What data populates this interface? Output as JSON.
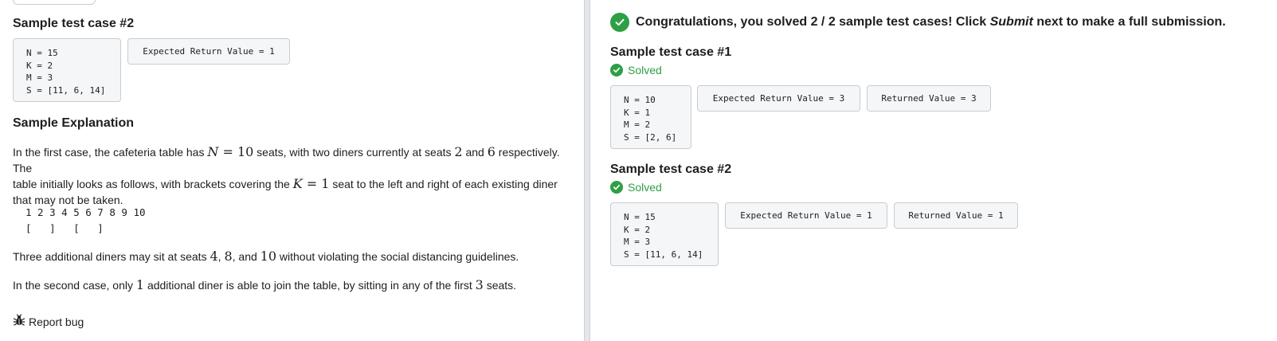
{
  "left": {
    "sample2": {
      "title": "Sample test case #2",
      "input_lines": [
        "N = 15",
        "K = 2",
        "M = 3",
        "S = [11, 6, 14]"
      ],
      "expected": "Expected Return Value = 1"
    },
    "explanation": {
      "title": "Sample Explanation",
      "p1_a": "In the first case, the cafeteria table has ",
      "p1_N": "N",
      "p1_eq1": " = ",
      "p1_10": "10",
      "p1_b": " seats, with two diners currently at seats ",
      "p1_2": "2",
      "p1_and": " and ",
      "p1_6": "6",
      "p1_c": " respectively. The",
      "p1_d": "table initially looks as follows, with brackets covering the ",
      "p1_K": "K",
      "p1_eq2": " = ",
      "p1_1": "1",
      "p1_e": " seat to the left and right of each existing diner",
      "p1_f": "that may not be taken.",
      "seat_numbers": "1 2 3 4 5 6 7 8 9 10",
      "seat_brackets": "[   ]   [   ]",
      "p2_a": "Three additional diners may sit at seats ",
      "p2_4": "4",
      "p2_c1": ", ",
      "p2_8": "8",
      "p2_c2": ", and ",
      "p2_10": "10",
      "p2_b": " without violating the social distancing guidelines.",
      "p3_a": "In the second case, only ",
      "p3_1": "1",
      "p3_b": " additional diner is able to join the table, by sitting in any of the first ",
      "p3_3": "3",
      "p3_c": " seats."
    },
    "report_bug": "Report bug"
  },
  "right": {
    "congrats_a": "Congratulations, you solved 2 / 2 sample test cases! Click ",
    "congrats_submit": "Submit",
    "congrats_b": " next to make a full submission.",
    "case1": {
      "title": "Sample test case #1",
      "status": "Solved",
      "input_lines": [
        "N = 10",
        "K = 1",
        "M = 2",
        "S = [2, 6]"
      ],
      "expected": "Expected Return Value = 3",
      "returned": "Returned Value = 3"
    },
    "case2": {
      "title": "Sample test case #2",
      "status": "Solved",
      "input_lines": [
        "N = 15",
        "K = 2",
        "M = 3",
        "S = [11, 6, 14]"
      ],
      "expected": "Expected Return Value = 1",
      "returned": "Returned Value = 1"
    }
  },
  "colors": {
    "success": "#2e9f45",
    "box_bg": "#f5f6f7",
    "border": "#c9ccd1"
  },
  "icons": {
    "check": "check-circle-icon",
    "bug": "bug-icon"
  }
}
